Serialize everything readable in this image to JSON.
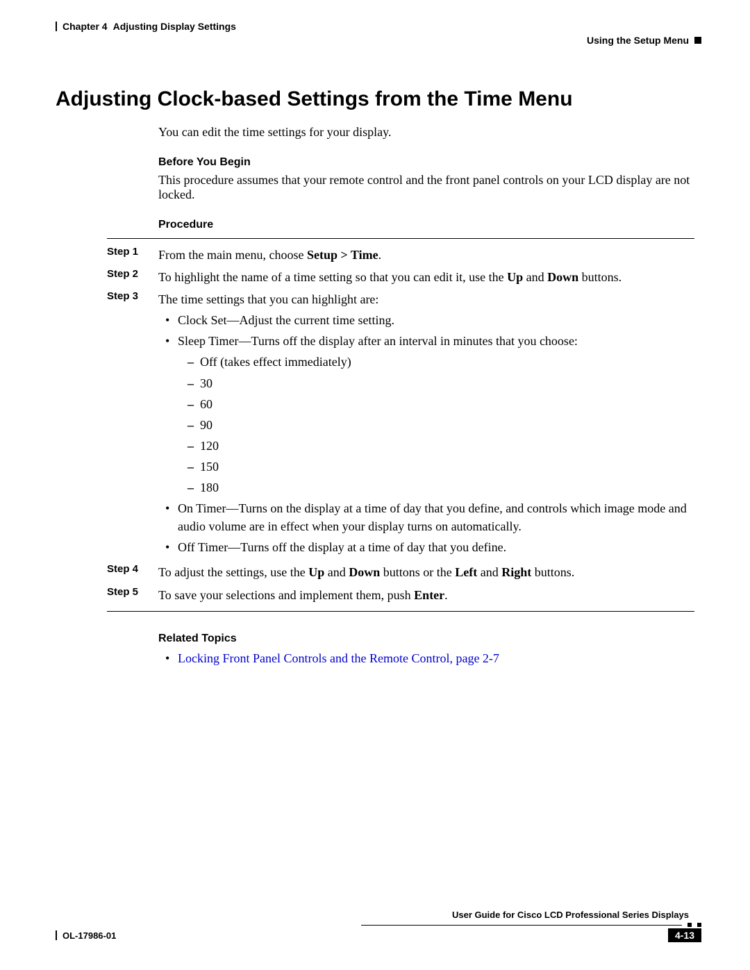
{
  "header": {
    "chapter": "Chapter 4",
    "chapter_title": "Adjusting Display Settings",
    "right": "Using the Setup Menu"
  },
  "title": "Adjusting Clock-based Settings from the Time Menu",
  "intro": "You can edit the time settings for your display.",
  "before_heading": "Before You Begin",
  "before_text": "This procedure assumes that your remote control and the front panel controls on your LCD display are not locked.",
  "procedure_heading": "Procedure",
  "steps": {
    "s1_label": "Step 1",
    "s1_a": "From the main menu, choose ",
    "s1_b": "Setup > Time",
    "s1_c": ".",
    "s2_label": "Step 2",
    "s2_a": "To highlight the name of a time setting so that you can edit it, use the ",
    "s2_b": "Up",
    "s2_c": " and ",
    "s2_d": "Down",
    "s2_e": " buttons.",
    "s3_label": "Step 3",
    "s3_intro": "The time settings that you can highlight are:",
    "s3_b1": "Clock Set—Adjust the current time setting.",
    "s3_b2": "Sleep Timer—Turns off the display after an interval in minutes that you choose:",
    "s3_d1": "Off (takes effect immediately)",
    "s3_d2": "30",
    "s3_d3": "60",
    "s3_d4": "90",
    "s3_d5": "120",
    "s3_d6": "150",
    "s3_d7": "180",
    "s3_b3": "On Timer—Turns on the display at a time of day that you define, and controls which image mode and audio volume are in effect when your display turns on automatically.",
    "s3_b4": "Off Timer—Turns off the display at a time of day that you define.",
    "s4_label": "Step 4",
    "s4_a": "To adjust the settings, use the ",
    "s4_b": "Up",
    "s4_c": " and ",
    "s4_d": "Down",
    "s4_e": " buttons or the ",
    "s4_f": "Left",
    "s4_g": " and ",
    "s4_h": "Right",
    "s4_i": " buttons.",
    "s5_label": "Step 5",
    "s5_a": "To save your selections and implement them, push ",
    "s5_b": "Enter",
    "s5_c": "."
  },
  "related_heading": "Related Topics",
  "related_link": "Locking Front Panel Controls and the Remote Control, page 2-7",
  "footer": {
    "guide": "User Guide for Cisco LCD Professional Series Displays",
    "code": "OL-17986-01",
    "page": "4-13"
  }
}
